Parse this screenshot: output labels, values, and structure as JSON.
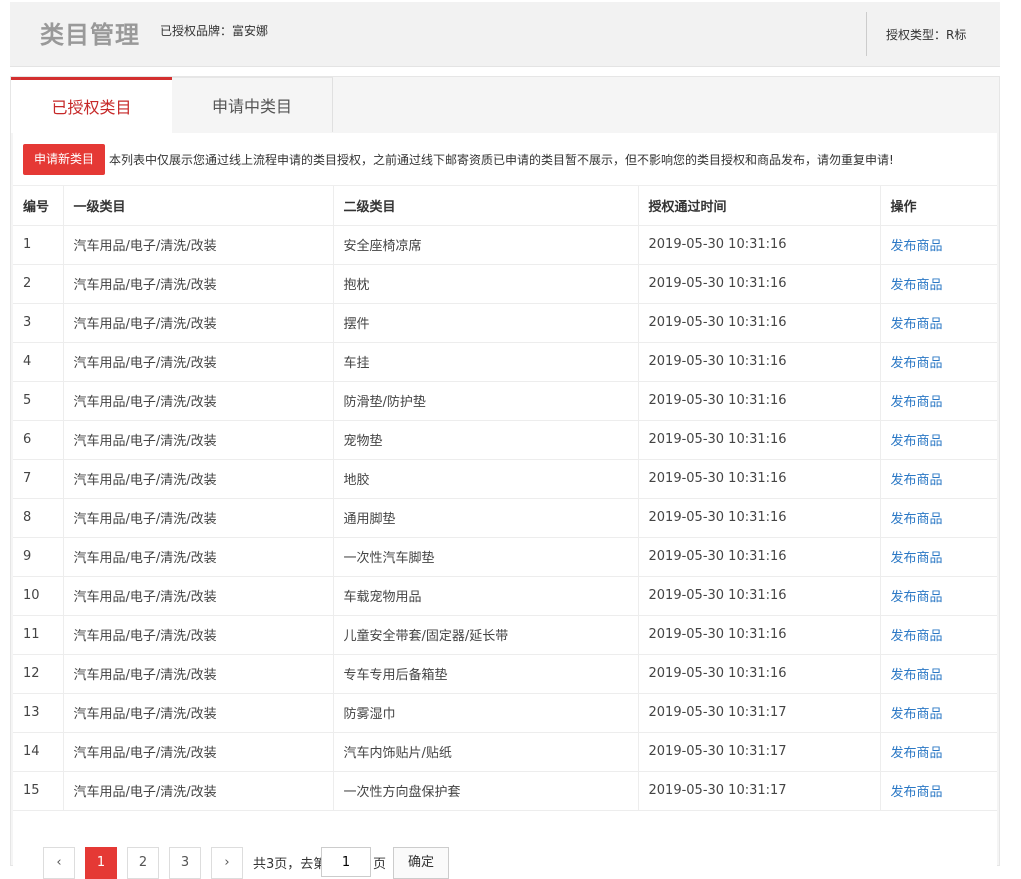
{
  "header": {
    "title": "类目管理",
    "brand": "已授权品牌：富安娜",
    "auth_type": "授权类型：R标"
  },
  "tabs": [
    {
      "label": "已授权类目"
    },
    {
      "label": "申请中类目"
    }
  ],
  "notice": {
    "apply_button": "申请新类目",
    "text": "本列表中仅展示您通过线上流程申请的类目授权，之前通过线下邮寄资质已申请的类目暂不展示，但不影响您的类目授权和商品发布，请勿重复申请!"
  },
  "table": {
    "columns": [
      "编号",
      "一级类目",
      "二级类目",
      "授权通过时间",
      "操作"
    ],
    "rows": [
      {
        "id": "1",
        "cat1": "汽车用品/电子/清洗/改装",
        "cat2": "安全座椅凉席",
        "time": "2019-05-30 10:31:16",
        "op": "发布商品"
      },
      {
        "id": "2",
        "cat1": "汽车用品/电子/清洗/改装",
        "cat2": "抱枕",
        "time": "2019-05-30 10:31:16",
        "op": "发布商品"
      },
      {
        "id": "3",
        "cat1": "汽车用品/电子/清洗/改装",
        "cat2": "摆件",
        "time": "2019-05-30 10:31:16",
        "op": "发布商品"
      },
      {
        "id": "4",
        "cat1": "汽车用品/电子/清洗/改装",
        "cat2": "车挂",
        "time": "2019-05-30 10:31:16",
        "op": "发布商品"
      },
      {
        "id": "5",
        "cat1": "汽车用品/电子/清洗/改装",
        "cat2": "防滑垫/防护垫",
        "time": "2019-05-30 10:31:16",
        "op": "发布商品"
      },
      {
        "id": "6",
        "cat1": "汽车用品/电子/清洗/改装",
        "cat2": "宠物垫",
        "time": "2019-05-30 10:31:16",
        "op": "发布商品"
      },
      {
        "id": "7",
        "cat1": "汽车用品/电子/清洗/改装",
        "cat2": "地胶",
        "time": "2019-05-30 10:31:16",
        "op": "发布商品"
      },
      {
        "id": "8",
        "cat1": "汽车用品/电子/清洗/改装",
        "cat2": "通用脚垫",
        "time": "2019-05-30 10:31:16",
        "op": "发布商品"
      },
      {
        "id": "9",
        "cat1": "汽车用品/电子/清洗/改装",
        "cat2": "一次性汽车脚垫",
        "time": "2019-05-30 10:31:16",
        "op": "发布商品"
      },
      {
        "id": "10",
        "cat1": "汽车用品/电子/清洗/改装",
        "cat2": "车载宠物用品",
        "time": "2019-05-30 10:31:16",
        "op": "发布商品"
      },
      {
        "id": "11",
        "cat1": "汽车用品/电子/清洗/改装",
        "cat2": "儿童安全带套/固定器/延长带",
        "time": "2019-05-30 10:31:16",
        "op": "发布商品"
      },
      {
        "id": "12",
        "cat1": "汽车用品/电子/清洗/改装",
        "cat2": "专车专用后备箱垫",
        "time": "2019-05-30 10:31:16",
        "op": "发布商品"
      },
      {
        "id": "13",
        "cat1": "汽车用品/电子/清洗/改装",
        "cat2": "防雾湿巾",
        "time": "2019-05-30 10:31:17",
        "op": "发布商品"
      },
      {
        "id": "14",
        "cat1": "汽车用品/电子/清洗/改装",
        "cat2": "汽车内饰贴片/贴纸",
        "time": "2019-05-30 10:31:17",
        "op": "发布商品"
      },
      {
        "id": "15",
        "cat1": "汽车用品/电子/清洗/改装",
        "cat2": "一次性方向盘保护套",
        "time": "2019-05-30 10:31:17",
        "op": "发布商品"
      }
    ]
  },
  "pagination": {
    "prev": "‹",
    "pages": [
      "1",
      "2",
      "3"
    ],
    "current": "1",
    "next": "›",
    "total_text": "共3页，去第",
    "input_value": "1",
    "page_suffix": "页",
    "confirm": "确定"
  },
  "colors": {
    "accent": "#e53935",
    "link": "#2b78c5"
  }
}
